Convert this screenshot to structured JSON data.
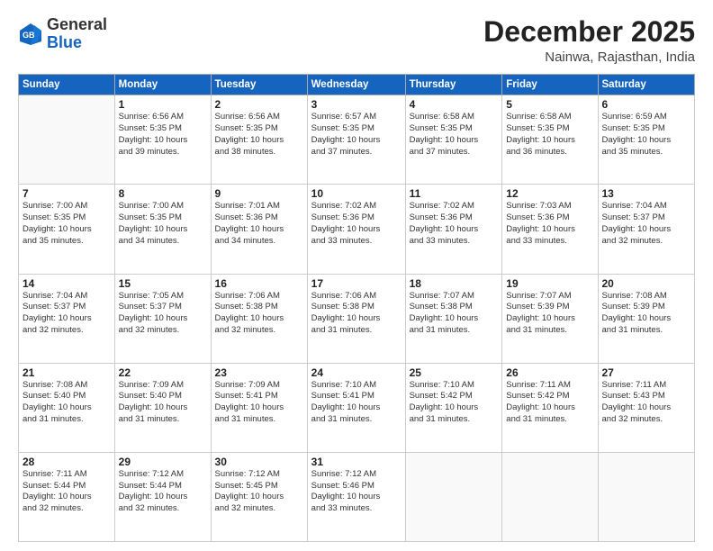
{
  "header": {
    "logo_line1": "General",
    "logo_line2": "Blue",
    "month": "December 2025",
    "location": "Nainwa, Rajasthan, India"
  },
  "days_of_week": [
    "Sunday",
    "Monday",
    "Tuesday",
    "Wednesday",
    "Thursday",
    "Friday",
    "Saturday"
  ],
  "weeks": [
    [
      {
        "day": "",
        "info": ""
      },
      {
        "day": "1",
        "info": "Sunrise: 6:56 AM\nSunset: 5:35 PM\nDaylight: 10 hours\nand 39 minutes."
      },
      {
        "day": "2",
        "info": "Sunrise: 6:56 AM\nSunset: 5:35 PM\nDaylight: 10 hours\nand 38 minutes."
      },
      {
        "day": "3",
        "info": "Sunrise: 6:57 AM\nSunset: 5:35 PM\nDaylight: 10 hours\nand 37 minutes."
      },
      {
        "day": "4",
        "info": "Sunrise: 6:58 AM\nSunset: 5:35 PM\nDaylight: 10 hours\nand 37 minutes."
      },
      {
        "day": "5",
        "info": "Sunrise: 6:58 AM\nSunset: 5:35 PM\nDaylight: 10 hours\nand 36 minutes."
      },
      {
        "day": "6",
        "info": "Sunrise: 6:59 AM\nSunset: 5:35 PM\nDaylight: 10 hours\nand 35 minutes."
      }
    ],
    [
      {
        "day": "7",
        "info": "Sunrise: 7:00 AM\nSunset: 5:35 PM\nDaylight: 10 hours\nand 35 minutes."
      },
      {
        "day": "8",
        "info": "Sunrise: 7:00 AM\nSunset: 5:35 PM\nDaylight: 10 hours\nand 34 minutes."
      },
      {
        "day": "9",
        "info": "Sunrise: 7:01 AM\nSunset: 5:36 PM\nDaylight: 10 hours\nand 34 minutes."
      },
      {
        "day": "10",
        "info": "Sunrise: 7:02 AM\nSunset: 5:36 PM\nDaylight: 10 hours\nand 33 minutes."
      },
      {
        "day": "11",
        "info": "Sunrise: 7:02 AM\nSunset: 5:36 PM\nDaylight: 10 hours\nand 33 minutes."
      },
      {
        "day": "12",
        "info": "Sunrise: 7:03 AM\nSunset: 5:36 PM\nDaylight: 10 hours\nand 33 minutes."
      },
      {
        "day": "13",
        "info": "Sunrise: 7:04 AM\nSunset: 5:37 PM\nDaylight: 10 hours\nand 32 minutes."
      }
    ],
    [
      {
        "day": "14",
        "info": "Sunrise: 7:04 AM\nSunset: 5:37 PM\nDaylight: 10 hours\nand 32 minutes."
      },
      {
        "day": "15",
        "info": "Sunrise: 7:05 AM\nSunset: 5:37 PM\nDaylight: 10 hours\nand 32 minutes."
      },
      {
        "day": "16",
        "info": "Sunrise: 7:06 AM\nSunset: 5:38 PM\nDaylight: 10 hours\nand 32 minutes."
      },
      {
        "day": "17",
        "info": "Sunrise: 7:06 AM\nSunset: 5:38 PM\nDaylight: 10 hours\nand 31 minutes."
      },
      {
        "day": "18",
        "info": "Sunrise: 7:07 AM\nSunset: 5:38 PM\nDaylight: 10 hours\nand 31 minutes."
      },
      {
        "day": "19",
        "info": "Sunrise: 7:07 AM\nSunset: 5:39 PM\nDaylight: 10 hours\nand 31 minutes."
      },
      {
        "day": "20",
        "info": "Sunrise: 7:08 AM\nSunset: 5:39 PM\nDaylight: 10 hours\nand 31 minutes."
      }
    ],
    [
      {
        "day": "21",
        "info": "Sunrise: 7:08 AM\nSunset: 5:40 PM\nDaylight: 10 hours\nand 31 minutes."
      },
      {
        "day": "22",
        "info": "Sunrise: 7:09 AM\nSunset: 5:40 PM\nDaylight: 10 hours\nand 31 minutes."
      },
      {
        "day": "23",
        "info": "Sunrise: 7:09 AM\nSunset: 5:41 PM\nDaylight: 10 hours\nand 31 minutes."
      },
      {
        "day": "24",
        "info": "Sunrise: 7:10 AM\nSunset: 5:41 PM\nDaylight: 10 hours\nand 31 minutes."
      },
      {
        "day": "25",
        "info": "Sunrise: 7:10 AM\nSunset: 5:42 PM\nDaylight: 10 hours\nand 31 minutes."
      },
      {
        "day": "26",
        "info": "Sunrise: 7:11 AM\nSunset: 5:42 PM\nDaylight: 10 hours\nand 31 minutes."
      },
      {
        "day": "27",
        "info": "Sunrise: 7:11 AM\nSunset: 5:43 PM\nDaylight: 10 hours\nand 32 minutes."
      }
    ],
    [
      {
        "day": "28",
        "info": "Sunrise: 7:11 AM\nSunset: 5:44 PM\nDaylight: 10 hours\nand 32 minutes."
      },
      {
        "day": "29",
        "info": "Sunrise: 7:12 AM\nSunset: 5:44 PM\nDaylight: 10 hours\nand 32 minutes."
      },
      {
        "day": "30",
        "info": "Sunrise: 7:12 AM\nSunset: 5:45 PM\nDaylight: 10 hours\nand 32 minutes."
      },
      {
        "day": "31",
        "info": "Sunrise: 7:12 AM\nSunset: 5:46 PM\nDaylight: 10 hours\nand 33 minutes."
      },
      {
        "day": "",
        "info": ""
      },
      {
        "day": "",
        "info": ""
      },
      {
        "day": "",
        "info": ""
      }
    ]
  ]
}
